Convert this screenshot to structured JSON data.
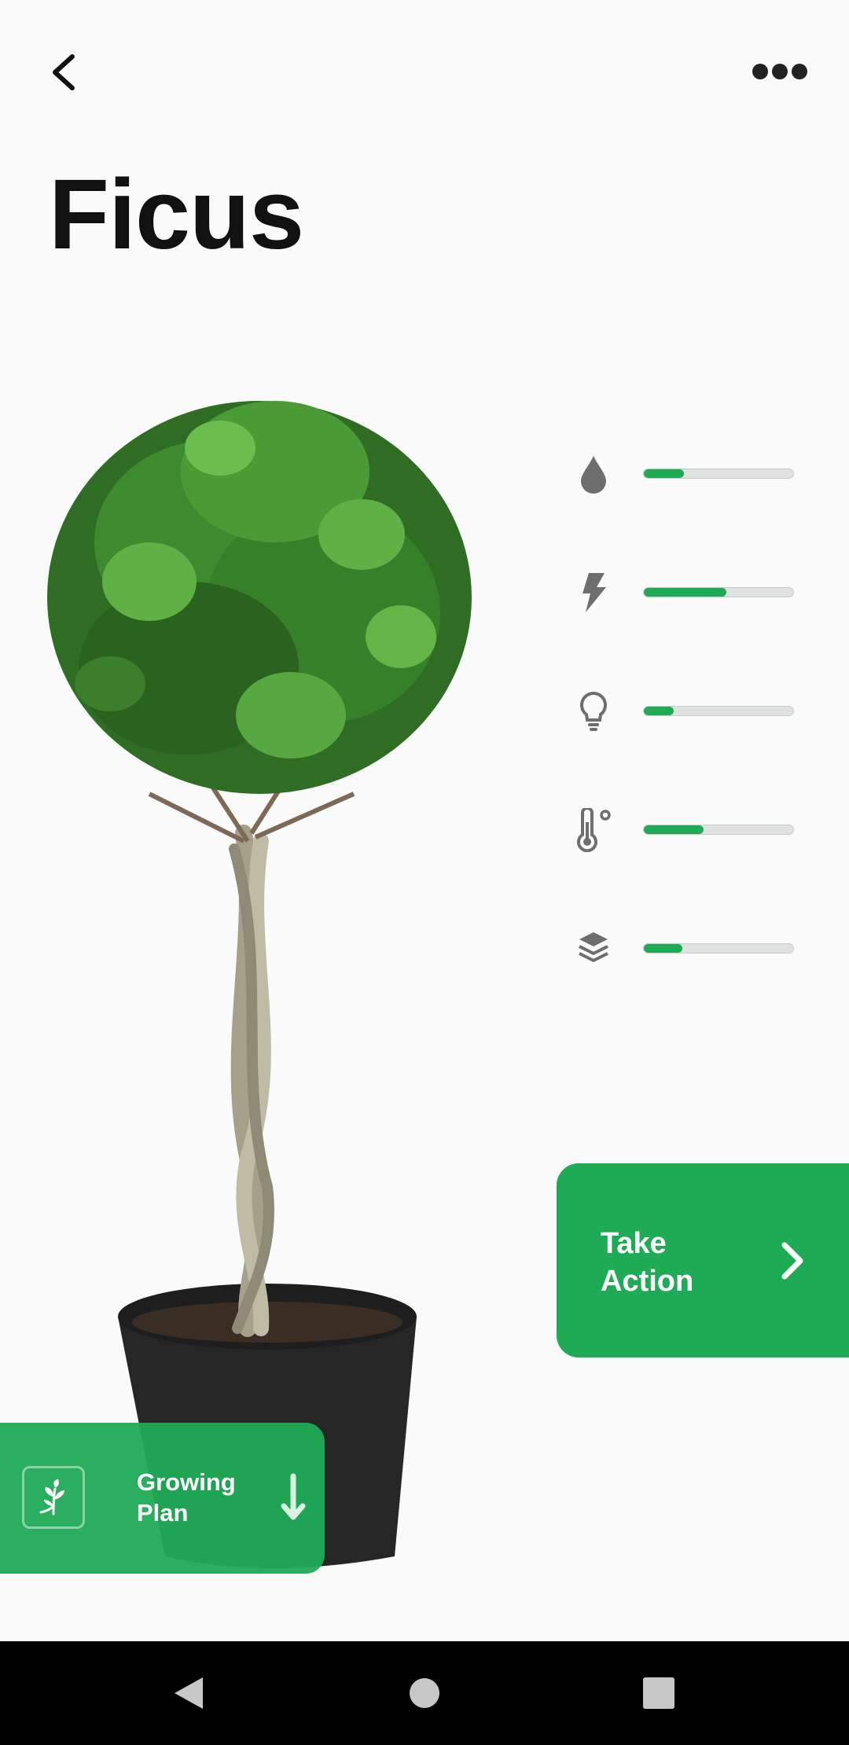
{
  "plant": {
    "name": "Ficus"
  },
  "header": {
    "back_icon": "chevron-left-icon",
    "menu_icon": "more-horizontal-icon"
  },
  "meters": [
    {
      "icon": "water-drop-icon",
      "level": 0.27,
      "color": "#1fab55"
    },
    {
      "icon": "lightning-icon",
      "level": 0.55,
      "color": "#1fab55"
    },
    {
      "icon": "lightbulb-icon",
      "level": 0.2,
      "color": "#1fab55"
    },
    {
      "icon": "temperature-icon",
      "level": 0.4,
      "color": "#1fab55"
    },
    {
      "icon": "layers-icon",
      "level": 0.26,
      "color": "#1fab55"
    }
  ],
  "take_action": {
    "label": "Take Action",
    "icon": "chevron-right-icon"
  },
  "growing_plan": {
    "label": "Growing Plan",
    "leaf_icon": "sprout-icon",
    "arrow_icon": "arrow-down-icon"
  },
  "navbar": {
    "back": "triangle-back-icon",
    "home": "circle-home-icon",
    "recents": "square-recents-icon"
  },
  "colors": {
    "accent": "#1fab55",
    "background": "#fafafa",
    "pot": "#262626"
  }
}
